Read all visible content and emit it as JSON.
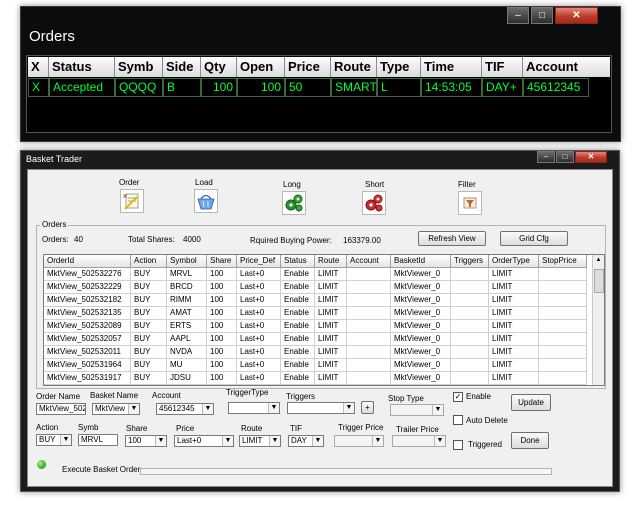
{
  "orders_window": {
    "title": "Orders",
    "minimize": "–",
    "maximize": "□",
    "close": "✕",
    "columns": [
      "X",
      "Status",
      "Symb",
      "Side",
      "Qty",
      "Open",
      "Price",
      "Route",
      "Type",
      "Time",
      "TIF",
      "Account"
    ],
    "row": {
      "x": "X",
      "status": "Accepted",
      "symb": "QQQQ",
      "side": "B",
      "qty": "100",
      "open": "100",
      "price": "50",
      "route": "SMART",
      "type": "L",
      "time": "14:53:05",
      "tif": "DAY+",
      "account": "45612345"
    }
  },
  "basket_window": {
    "title": "Basket Trader",
    "toolbar": {
      "order": "Order",
      "load": "Load",
      "long": "Long",
      "short": "Short",
      "filter": "Filter"
    },
    "orders_group": {
      "label": "Orders",
      "orders_label": "Orders:",
      "orders_value": "40",
      "total_shares_label": "Total Shares:",
      "total_shares_value": "4000",
      "buying_power_label": "Rquired Buying Power:",
      "buying_power_value": "163379.00",
      "refresh_button": "Refresh View",
      "grid_cfg_button": "Grid Cfg"
    },
    "grid": {
      "columns": [
        "OrderId",
        "Action",
        "Symbol",
        "Share",
        "Price_Def",
        "Status",
        "Route",
        "Account",
        "BasketId",
        "Triggers",
        "OrderType",
        "StopPrice"
      ],
      "rows": [
        [
          "MktView_502532276",
          "BUY",
          "MRVL",
          "100",
          "Last+0",
          "Enable",
          "LIMIT",
          "",
          "MktViewer_0",
          "",
          "LIMIT",
          ""
        ],
        [
          "MktView_502532229",
          "BUY",
          "BRCD",
          "100",
          "Last+0",
          "Enable",
          "LIMIT",
          "",
          "MktViewer_0",
          "",
          "LIMIT",
          ""
        ],
        [
          "MktView_502532182",
          "BUY",
          "RIMM",
          "100",
          "Last+0",
          "Enable",
          "LIMIT",
          "",
          "MktViewer_0",
          "",
          "LIMIT",
          ""
        ],
        [
          "MktView_502532135",
          "BUY",
          "AMAT",
          "100",
          "Last+0",
          "Enable",
          "LIMIT",
          "",
          "MktViewer_0",
          "",
          "LIMIT",
          ""
        ],
        [
          "MktView_502532089",
          "BUY",
          "ERTS",
          "100",
          "Last+0",
          "Enable",
          "LIMIT",
          "",
          "MktViewer_0",
          "",
          "LIMIT",
          ""
        ],
        [
          "MktView_502532057",
          "BUY",
          "AAPL",
          "100",
          "Last+0",
          "Enable",
          "LIMIT",
          "",
          "MktViewer_0",
          "",
          "LIMIT",
          ""
        ],
        [
          "MktView_502532011",
          "BUY",
          "NVDA",
          "100",
          "Last+0",
          "Enable",
          "LIMIT",
          "",
          "MktViewer_0",
          "",
          "LIMIT",
          ""
        ],
        [
          "MktView_502531964",
          "BUY",
          "MU",
          "100",
          "Last+0",
          "Enable",
          "LIMIT",
          "",
          "MktViewer_0",
          "",
          "LIMIT",
          ""
        ],
        [
          "MktView_502531917",
          "BUY",
          "JDSU",
          "100",
          "Last+0",
          "Enable",
          "LIMIT",
          "",
          "MktViewer_0",
          "",
          "LIMIT",
          ""
        ]
      ]
    },
    "form": {
      "order_name_label": "Order Name",
      "order_name_value": "MktView_502",
      "basket_name_label": "Basket Name",
      "basket_name_value": "MktView",
      "account_label": "Account",
      "account_value": "45612345",
      "trigger_type_label": "TriggerType",
      "trigger_type_value": "",
      "triggers_label": "Triggers",
      "triggers_value": "",
      "add_trigger": "+",
      "stop_type_label": "Stop Type",
      "stop_type_value": "",
      "enable_label": "Enable",
      "enable_checked": true,
      "auto_delete_label": "Auto Delete",
      "auto_delete_checked": false,
      "triggered_label": "Triggered",
      "triggered_checked": false,
      "update_button": "Update",
      "done_button": "Done",
      "action_label": "Action",
      "action_value": "BUY",
      "symb_label": "Symb",
      "symb_value": "MRVL",
      "share_label": "Share",
      "share_value": "100",
      "price_label": "Price",
      "price_value": "Last+0",
      "route_label": "Route",
      "route_value": "LIMIT",
      "tif_label": "TIF",
      "tif_value": "DAY",
      "trigger_price_label": "Trigger Price",
      "trigger_price_value": "",
      "trailer_price_label": "Trailer Price",
      "trailer_price_value": ""
    },
    "execute_label": "Execute Basket Order",
    "colors": {
      "status_green": "#22aa22",
      "grid_text": "#00ff33"
    }
  }
}
